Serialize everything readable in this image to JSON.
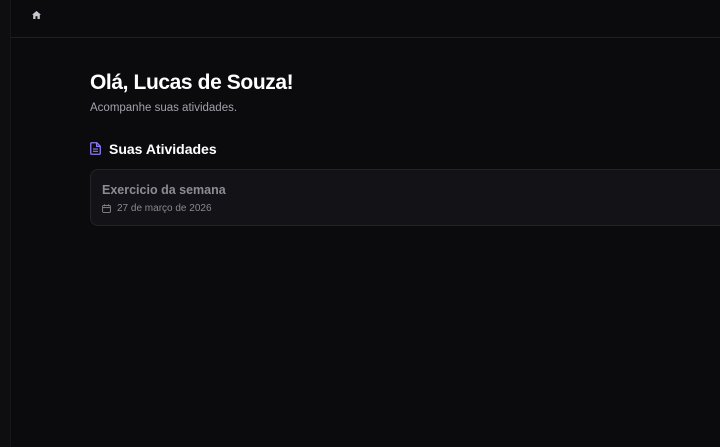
{
  "topbar": {
    "home_icon": "home-icon"
  },
  "main": {
    "greeting": "Olá, Lucas de Souza!",
    "subtitle": "Acompanhe suas atividades.",
    "section": {
      "icon": "document-icon",
      "title": "Suas Atividades"
    },
    "activities": [
      {
        "title": "Exercicio da semana",
        "icon": "calendar-icon",
        "date": "27 de março de 2026"
      }
    ]
  },
  "colors": {
    "background": "#0b0a0d",
    "card": "#131217",
    "accent": "#8b7cf6",
    "muted_text": "#a3a1aa"
  }
}
